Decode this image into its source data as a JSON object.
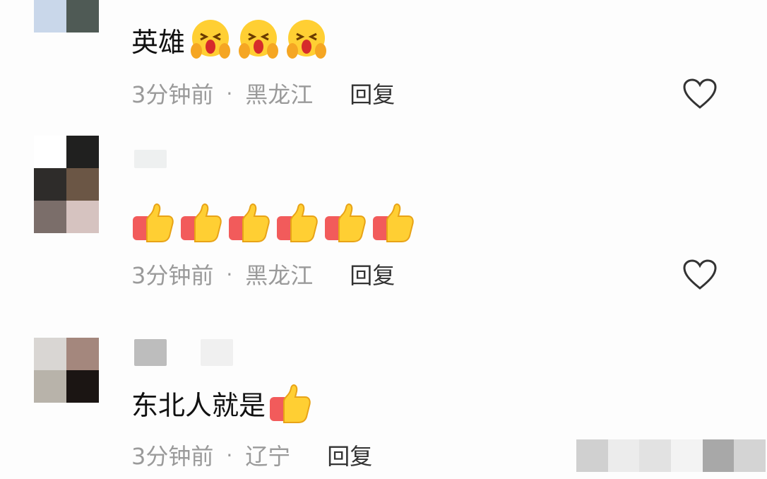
{
  "comments": [
    {
      "text": "英雄",
      "emoji_icon": "grimace-face-icon",
      "emoji_count": 3,
      "time": "3分钟前",
      "separator": "·",
      "location": "黑龙江",
      "reply_label": "回复",
      "like_icon": "heart-outline-icon"
    },
    {
      "text": "",
      "emoji_icon": "thumbs-up-icon",
      "emoji_count": 6,
      "time": "3分钟前",
      "separator": "·",
      "location": "黑龙江",
      "reply_label": "回复",
      "like_icon": "heart-outline-icon"
    },
    {
      "text": "东北人就是",
      "emoji_icon": "thumbs-up-icon",
      "emoji_count": 1,
      "time": "3分钟前",
      "separator": "·",
      "location": "辽宁",
      "reply_label": "回复"
    }
  ],
  "colors": {
    "text": "#111111",
    "meta": "#9a9a9a",
    "reply": "#333333",
    "heart": "#333333"
  }
}
